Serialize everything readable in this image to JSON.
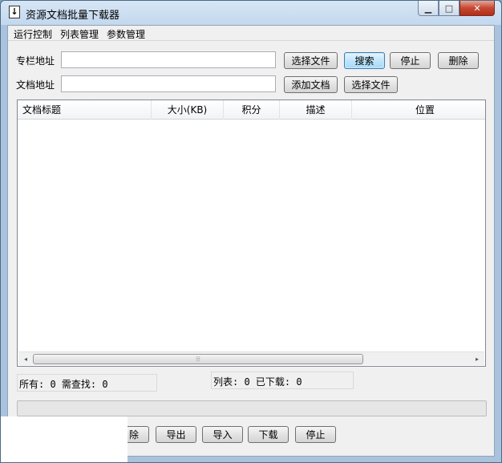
{
  "window": {
    "title": "资源文档批量下载器",
    "minimize_glyph": "▁",
    "maximize_glyph": "□",
    "close_glyph": "✕",
    "app_icon_glyph": "↓"
  },
  "menu": [
    "运行控制",
    "列表管理",
    "参数管理"
  ],
  "column_url": {
    "label": "专栏地址",
    "value": "",
    "select_file_btn": "选择文件",
    "search_btn": "搜索",
    "stop_btn": "停止",
    "delete_btn": "删除"
  },
  "doc_url": {
    "label": "文档地址",
    "value": "",
    "add_doc_btn": "添加文档",
    "select_file_btn": "选择文件"
  },
  "list": {
    "columns": [
      "文档标题",
      "大小(KB)",
      "积分",
      "描述",
      "位置"
    ],
    "rows": [],
    "scroll_left": "◂",
    "scroll_right": "▸",
    "scroll_grip": "⦙⦙⦙"
  },
  "status": {
    "left": "所有: 0 需查找: 0",
    "right": "列表: 0 已下载: 0"
  },
  "progress": {
    "percent": 0
  },
  "bottom_buttons": {
    "remove": "除",
    "export": "导出",
    "import": "导入",
    "download": "下载",
    "stop": "停止"
  },
  "colors": {
    "accent": "#3c7fb1",
    "close_button": "#c5472f",
    "progress": "#06b025"
  }
}
